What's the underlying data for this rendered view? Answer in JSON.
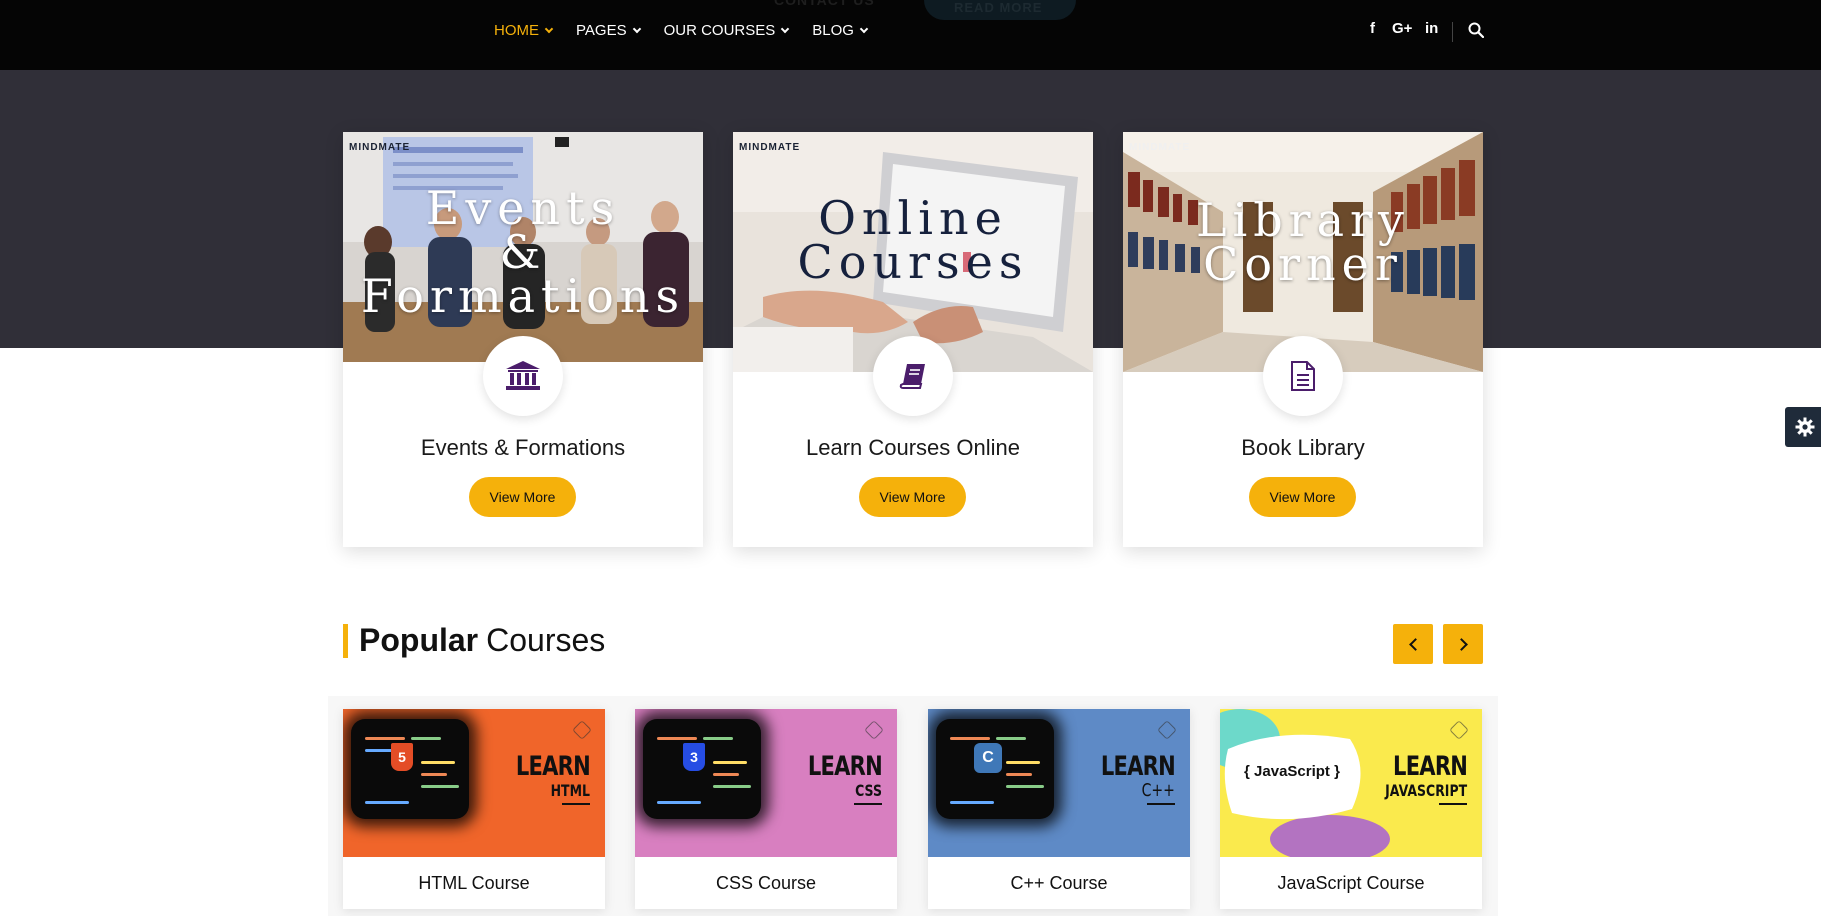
{
  "ghost": {
    "contact": "CONTACT US",
    "read_more": "READ MORE"
  },
  "nav": {
    "items": [
      {
        "label": "HOME",
        "active": true
      },
      {
        "label": "PAGES",
        "active": false
      },
      {
        "label": "OUR COURSES",
        "active": false
      },
      {
        "label": "BLOG",
        "active": false
      }
    ],
    "social": {
      "facebook": "f",
      "google": "G+",
      "linkedin": "in"
    }
  },
  "features": [
    {
      "image_text": [
        "Events",
        "&",
        "Formations"
      ],
      "brand": "MINDMATE",
      "icon": "bank-icon",
      "title": "Events & Formations",
      "button": "View More"
    },
    {
      "image_text": [
        "Online",
        "Courses"
      ],
      "brand": "MINDMATE",
      "icon": "book-icon",
      "title": "Learn Courses Online",
      "button": "View More"
    },
    {
      "image_text": [
        "Library",
        "Corner"
      ],
      "brand": "MINDMATE",
      "icon": "document-icon",
      "title": "Book Library",
      "button": "View More"
    }
  ],
  "section": {
    "bold": "Popular",
    "light": "Courses"
  },
  "courses": [
    {
      "learn": "LEARN",
      "lang": "HTML",
      "name": "HTML Course",
      "bg": "#f0652a",
      "badge": "5"
    },
    {
      "learn": "LEARN",
      "lang": "CSS",
      "name": "CSS Course",
      "bg": "#d87fc0",
      "badge": "3"
    },
    {
      "learn": "LEARN",
      "lang": "C++",
      "name": "C++ Course",
      "bg": "#5e8ac6",
      "badge": "C"
    },
    {
      "learn": "LEARN",
      "lang": "JAVASCRIPT",
      "name": "JavaScript Course",
      "bg": "#faea4d",
      "badge": "{ JavaScript }"
    }
  ],
  "colors": {
    "accent": "#f5b10b",
    "navbar": "#050505",
    "band": "#302f38",
    "icon": "#4b1d6b"
  }
}
